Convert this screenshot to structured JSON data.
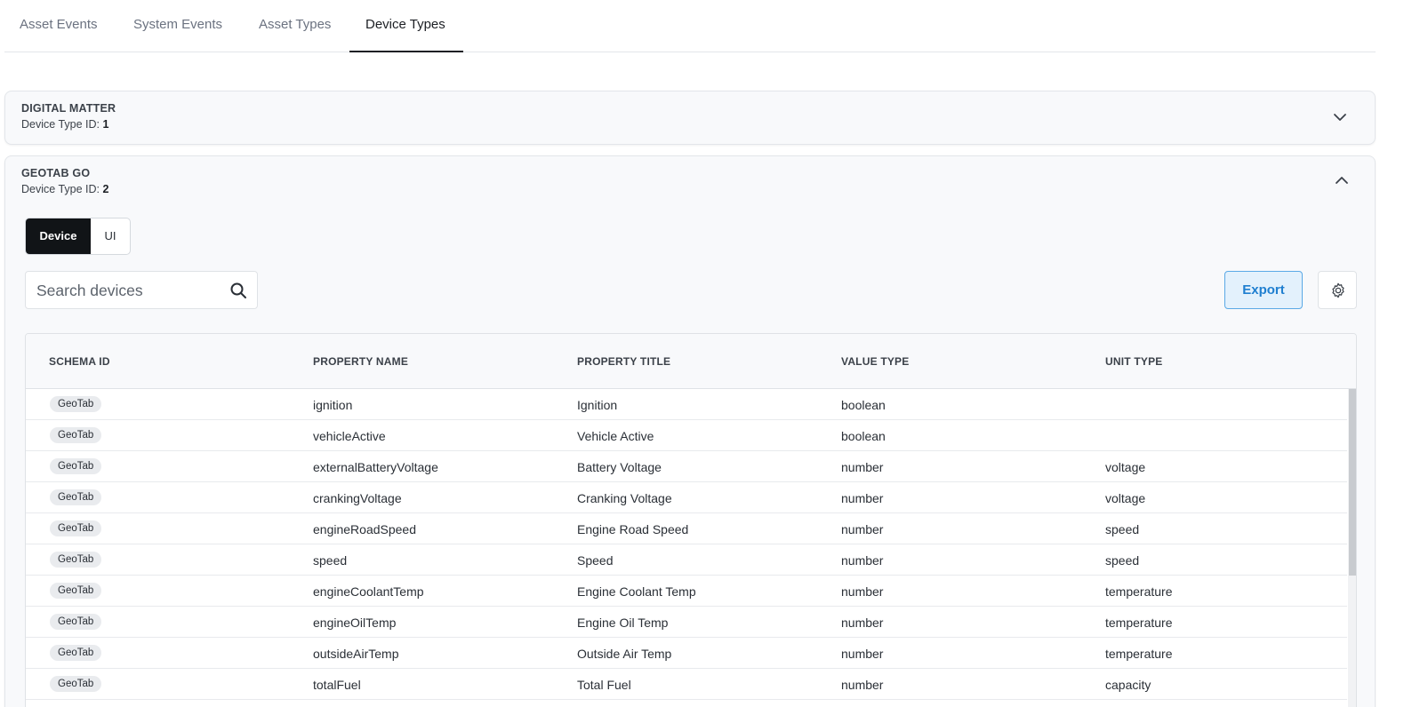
{
  "tabs": [
    {
      "label": "Asset Events",
      "active": false
    },
    {
      "label": "System Events",
      "active": false
    },
    {
      "label": "Asset Types",
      "active": false
    },
    {
      "label": "Device Types",
      "active": true
    }
  ],
  "device_types": [
    {
      "name": "DIGITAL MATTER",
      "id_label": "Device Type ID:",
      "id": "1",
      "expanded": false,
      "chevron": "chevron-down-icon"
    },
    {
      "name": "GEOTAB GO",
      "id_label": "Device Type ID:",
      "id": "2",
      "expanded": true,
      "chevron": "chevron-up-icon"
    }
  ],
  "segment": {
    "device": "Device",
    "ui": "UI",
    "selected": "Device"
  },
  "search": {
    "placeholder": "Search devices",
    "value": ""
  },
  "toolbar": {
    "export_label": "Export",
    "settings_icon": "gear-icon"
  },
  "table": {
    "columns": [
      "SCHEMA ID",
      "PROPERTY NAME",
      "PROPERTY TITLE",
      "VALUE TYPE",
      "UNIT TYPE"
    ],
    "rows": [
      {
        "schema": "GeoTab",
        "name": "ignition",
        "title": "Ignition",
        "value_type": "boolean",
        "unit": ""
      },
      {
        "schema": "GeoTab",
        "name": "vehicleActive",
        "title": "Vehicle Active",
        "value_type": "boolean",
        "unit": ""
      },
      {
        "schema": "GeoTab",
        "name": "externalBatteryVoltage",
        "title": "Battery Voltage",
        "value_type": "number",
        "unit": "voltage"
      },
      {
        "schema": "GeoTab",
        "name": "crankingVoltage",
        "title": "Cranking Voltage",
        "value_type": "number",
        "unit": "voltage"
      },
      {
        "schema": "GeoTab",
        "name": "engineRoadSpeed",
        "title": "Engine Road Speed",
        "value_type": "number",
        "unit": "speed"
      },
      {
        "schema": "GeoTab",
        "name": "speed",
        "title": "Speed",
        "value_type": "number",
        "unit": "speed"
      },
      {
        "schema": "GeoTab",
        "name": "engineCoolantTemp",
        "title": "Engine Coolant Temp",
        "value_type": "number",
        "unit": "temperature"
      },
      {
        "schema": "GeoTab",
        "name": "engineOilTemp",
        "title": "Engine Oil Temp",
        "value_type": "number",
        "unit": "temperature"
      },
      {
        "schema": "GeoTab",
        "name": "outsideAirTemp",
        "title": "Outside Air Temp",
        "value_type": "number",
        "unit": "temperature"
      },
      {
        "schema": "GeoTab",
        "name": "totalFuel",
        "title": "Total Fuel",
        "value_type": "number",
        "unit": "capacity"
      }
    ]
  },
  "colors": {
    "accent": "#1f7fd0",
    "tab_active": "#1c1f24",
    "segment_on": "#111417"
  }
}
